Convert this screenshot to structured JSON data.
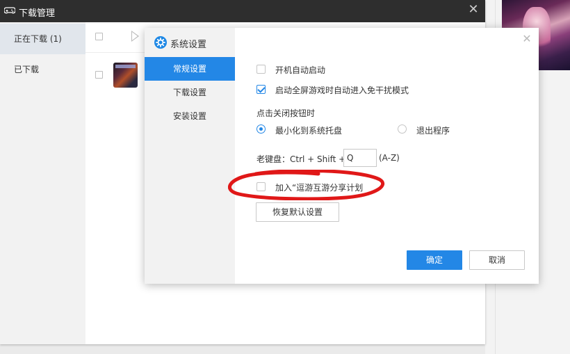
{
  "download_manager": {
    "title": "下载管理",
    "close_glyph": "✕",
    "sidebar": [
      {
        "label": "正在下载 (1)",
        "active": true
      },
      {
        "label": "已下载",
        "active": false
      }
    ]
  },
  "settings_dialog": {
    "title": "系统设置",
    "close_glyph": "✕",
    "nav": [
      {
        "label": "常规设置",
        "active": true
      },
      {
        "label": "下载设置",
        "active": false
      },
      {
        "label": "安装设置",
        "active": false
      }
    ],
    "options": {
      "autostart": {
        "label": "开机自动启动",
        "checked": false
      },
      "fullscreen_mode": {
        "label": "启动全屏游戏时自动进入免干扰模式",
        "checked": true
      },
      "close_section_label": "点击关闭按钮时",
      "minimize_tray": {
        "label": "最小化到系统托盘",
        "selected": true
      },
      "exit_program": {
        "label": "退出程序",
        "selected": false
      },
      "boss_key": {
        "label": "老键盘：Ctrl + Shift +",
        "value": "Q",
        "range": "(A-Z)"
      },
      "share_plan": {
        "label": "加入“逗游互游分享计划",
        "checked": false
      }
    },
    "buttons": {
      "restore_defaults": "恢复默认设置",
      "ok": "确定",
      "cancel": "取消"
    }
  },
  "colors": {
    "accent": "#2387e6",
    "titlebar": "#2e2e2e",
    "annotation": "#e01818"
  },
  "icons": {
    "gamepad": "gamepad-icon",
    "gear": "gear-icon",
    "play": "play-icon",
    "close": "close-icon"
  }
}
